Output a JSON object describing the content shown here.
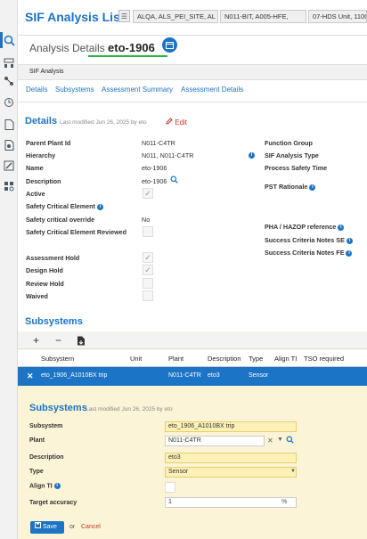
{
  "app_title": "SIF Analysis List",
  "breadcrumbs": [
    "ALQA, ALS_PEI_SITE, AL",
    "N011-BIT, A005-HFE,",
    "07-HDS Unit, 1100, 1"
  ],
  "page": {
    "title_prefix": "Analysis Details",
    "title_id": "eto-1906"
  },
  "section_bar": "SIF Analysis",
  "tabs": [
    "Details",
    "Subsystems",
    "Assessment Summary",
    "Assessment Details"
  ],
  "details": {
    "title": "Details",
    "modified": "Last modified Jun 26, 2025 by eto",
    "edit_label": "Edit",
    "fields": {
      "parent_plant_id": {
        "label": "Parent Plant Id",
        "value": "N011-C4TR"
      },
      "hierarchy": {
        "label": "Hierarchy",
        "value": "N011, N011-C4TR"
      },
      "name": {
        "label": "Name",
        "value": "eto-1906"
      },
      "description": {
        "label": "Description",
        "value": "eto-1906"
      },
      "active": {
        "label": "Active"
      },
      "safety_critical_element": {
        "label": "Safety Critical Element"
      },
      "safety_critical_override": {
        "label": "Safety critical override",
        "value": "No"
      },
      "safety_critical_reviewed": {
        "label": "Safety Critical Element Reviewed"
      },
      "assessment_hold": {
        "label": "Assessment Hold"
      },
      "design_hold": {
        "label": "Design Hold"
      },
      "review_hold": {
        "label": "Review Hold"
      },
      "waived": {
        "label": "Waived"
      }
    },
    "right_fields": {
      "function_group": "Function Group",
      "sif_analysis_type": "SIF Analysis Type",
      "process_safety_time": "Process Safety Time",
      "pst_rationale": "PST Rationale",
      "pha_hazop": "PHA / HAZOP reference",
      "success_se": "Success Criteria Notes SE",
      "success_fe": "Success Criteria Notes FE"
    }
  },
  "subsystems": {
    "title": "Subsystems",
    "toolbar": {
      "add": "+",
      "remove": "−"
    },
    "columns": [
      "Subsystem",
      "Unit",
      "Plant",
      "Description",
      "Type",
      "Align TI",
      "TSO required"
    ],
    "rows": [
      {
        "subsystem": "eto_1906_A1010BX trip",
        "unit": "",
        "plant": "N011-C4TR",
        "description": "eto3",
        "type": "Sensor",
        "align_ti": "",
        "tso": ""
      }
    ]
  },
  "subsystem_form": {
    "title": "Subsystems",
    "modified": "Last modified Jun 26, 2025 by eto",
    "subsystem": {
      "label": "Subsystem",
      "value": "eto_1906_A1010BX trip"
    },
    "plant": {
      "label": "Plant",
      "value": "N011-C4TR"
    },
    "description": {
      "label": "Description",
      "value": "eto3"
    },
    "type": {
      "label": "Type",
      "value": "Sensor"
    },
    "align_ti": {
      "label": "Align TI"
    },
    "target_accuracy": {
      "label": "Target accuracy",
      "value": "1",
      "unit": "%"
    },
    "save_label": "Save",
    "or_label": "or",
    "cancel_label": "Cancel"
  },
  "colors": {
    "accent": "#1b74c5",
    "green": "#2bb24c",
    "edit": "#c0392b",
    "form_bg": "#fbf4d6"
  }
}
